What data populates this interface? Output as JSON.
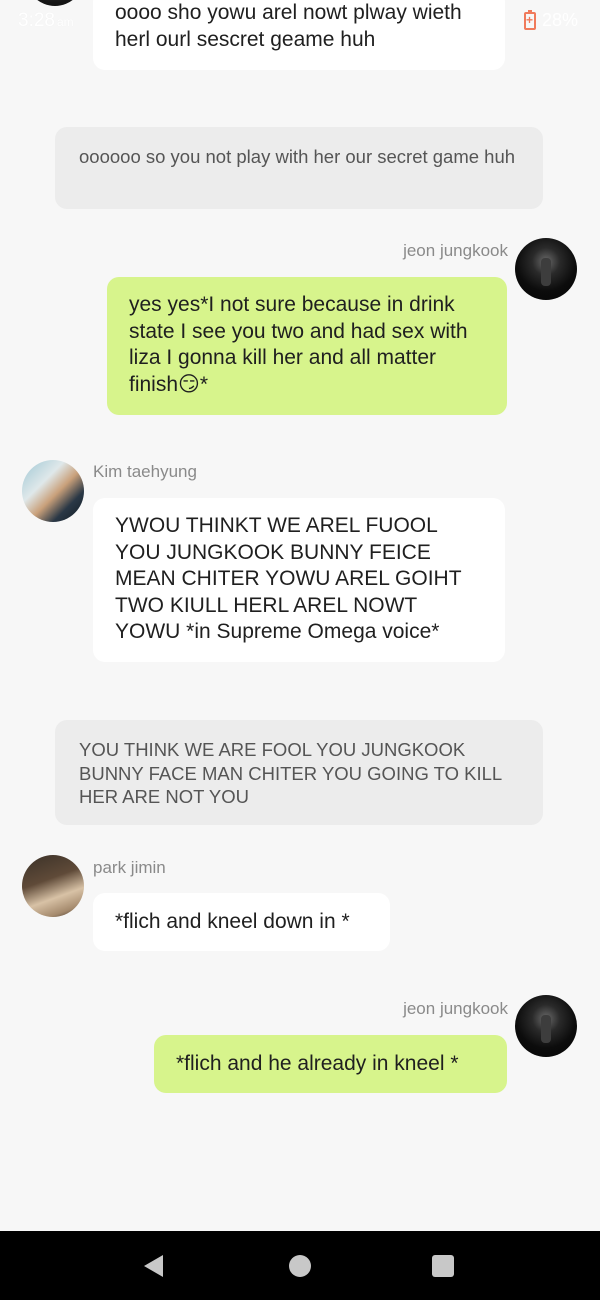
{
  "status_bar": {
    "time": "3:28",
    "ampm": "am",
    "battery": "28%"
  },
  "messages": [
    {
      "type": "incoming",
      "text": "oooo sho yowu arel nowt plway wieth herl ourl sescret geame huh"
    },
    {
      "type": "narration",
      "text": "oooooo so you not play with her our secret game huh"
    },
    {
      "type": "outgoing",
      "sender": "jeon jungkook",
      "text": "yes yes*I not sure because in drink state I see you two and had sex with liza I gonna kill her and all matter finish😏*"
    },
    {
      "type": "incoming",
      "sender": "Kim taehyung",
      "text": "YWOU THINKT WE AREL FUOOL YOU JUNGKOOK BUNNY FEICE MEAN CHITER YOWU AREL GOIHT TWO KIULL HERL AREL NOWT YOWU *in Supreme Omega voice*"
    },
    {
      "type": "narration",
      "text": "YOU THINK WE ARE FOOL YOU JUNGKOOK BUNNY FACE MAN CHITER  YOU GOING TO KILL HER ARE NOT YOU"
    },
    {
      "type": "incoming",
      "sender": "park jimin",
      "text": "*flich and kneel down in *"
    },
    {
      "type": "outgoing",
      "sender": "jeon jungkook",
      "text": "*flich and he already in  kneel *"
    }
  ],
  "colors": {
    "background": "#f7f7f7",
    "outgoing_bubble": "#d7f48c",
    "incoming_bubble": "#ffffff",
    "narration_bubble": "#ececec"
  },
  "nav": {
    "back_icon": "back-triangle-icon",
    "home_icon": "home-circle-icon",
    "recents_icon": "recents-square-icon"
  }
}
